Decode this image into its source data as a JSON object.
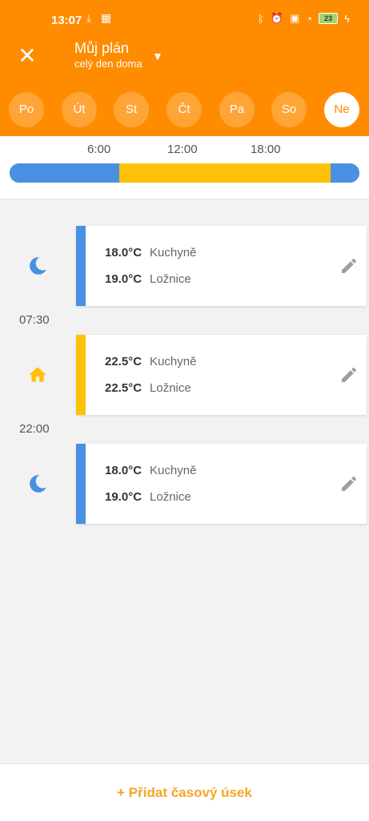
{
  "status": {
    "time": "13:07",
    "battery": "23"
  },
  "header": {
    "title": "Můj plán",
    "subtitle": "celý den doma",
    "close_icon": "close-icon",
    "dropdown_icon": "dropdown-arrow-icon"
  },
  "days": [
    {
      "label": "Po"
    },
    {
      "label": "Út"
    },
    {
      "label": "St"
    },
    {
      "label": "Čt"
    },
    {
      "label": "Pa"
    },
    {
      "label": "So"
    },
    {
      "label": "Ne",
      "active": true
    }
  ],
  "timeline": {
    "labels": [
      "6:00",
      "12:00",
      "18:00"
    ],
    "segments": [
      {
        "mode": "night",
        "start": "0:00",
        "end": "7:30"
      },
      {
        "mode": "home",
        "start": "7:30",
        "end": "22:00"
      },
      {
        "mode": "night",
        "start": "22:00",
        "end": "24:00"
      }
    ],
    "colors": {
      "night": "#4a90e2",
      "home": "#ffc107"
    }
  },
  "schedule": [
    {
      "mode": "night",
      "icon": "moon-icon",
      "rows": [
        {
          "temp": "18.0°C",
          "room": "Kuchyně"
        },
        {
          "temp": "19.0°C",
          "room": "Ložnice"
        }
      ]
    },
    {
      "time_label": "07:30"
    },
    {
      "mode": "home",
      "icon": "home-icon",
      "rows": [
        {
          "temp": "22.5°C",
          "room": "Kuchyně"
        },
        {
          "temp": "22.5°C",
          "room": "Ložnice"
        }
      ]
    },
    {
      "time_label": "22:00"
    },
    {
      "mode": "night",
      "icon": "moon-icon",
      "rows": [
        {
          "temp": "18.0°C",
          "room": "Kuchyně"
        },
        {
          "temp": "19.0°C",
          "room": "Ložnice"
        }
      ]
    }
  ],
  "footer": {
    "add_label": "+ Přidat časový úsek"
  },
  "colors": {
    "brand": "#ff8c00",
    "accent_text": "#f5a623"
  }
}
